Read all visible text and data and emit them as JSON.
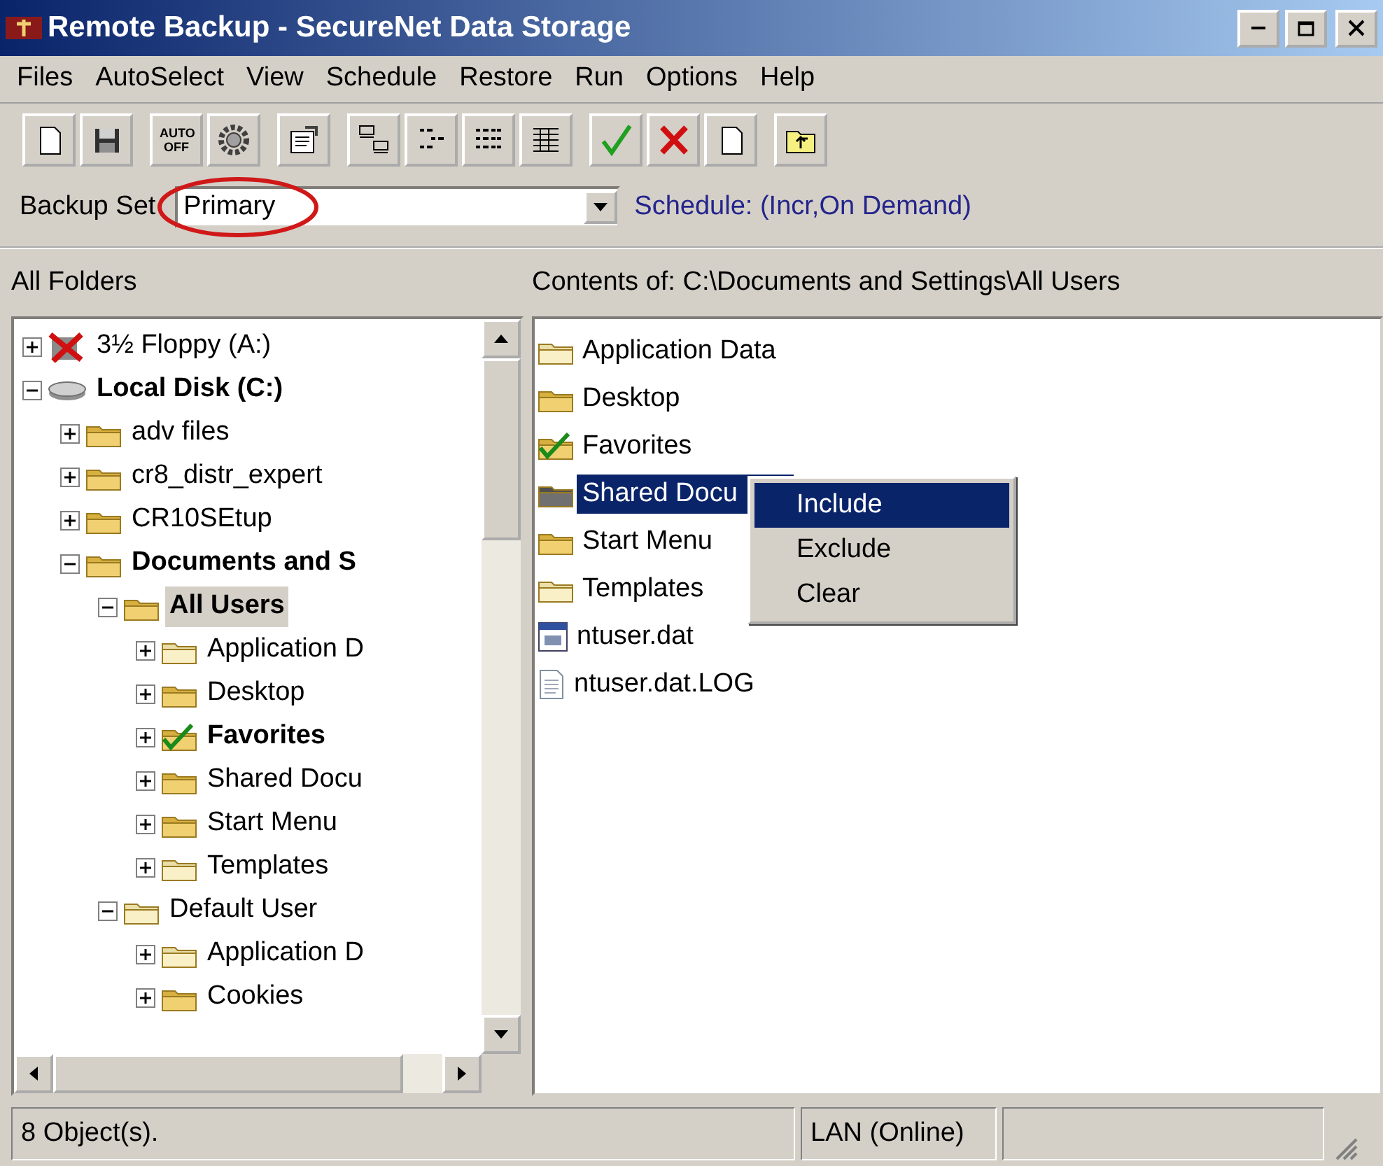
{
  "window": {
    "title": "Remote Backup - SecureNet Data Storage"
  },
  "menu": [
    {
      "label": "Files"
    },
    {
      "label": "AutoSelect"
    },
    {
      "label": "View"
    },
    {
      "label": "Schedule"
    },
    {
      "label": "Restore"
    },
    {
      "label": "Run"
    },
    {
      "label": "Options"
    },
    {
      "label": "Help"
    }
  ],
  "toolbar": {
    "auto_button": "AUTO OFF"
  },
  "backup_set": {
    "label": "Backup Set",
    "value": "Primary",
    "circled": true
  },
  "schedule": "Schedule: (Incr,On Demand)",
  "folders_pane": {
    "title": "All Folders",
    "tree": [
      {
        "label": "3½ Floppy (A:)",
        "kind": "floppy",
        "excluded": true,
        "bold": false,
        "selected": false,
        "expanded": false
      },
      {
        "label": "Local Disk (C:)",
        "kind": "disk",
        "bold": true,
        "selected": false,
        "expanded": true,
        "children": [
          {
            "label": "adv files",
            "kind": "folder",
            "faded": false,
            "checked": false,
            "bold": false,
            "selected": false,
            "expanded": false
          },
          {
            "label": "cr8_distr_expert",
            "kind": "folder",
            "faded": false,
            "checked": false,
            "bold": false,
            "selected": false,
            "expanded": false
          },
          {
            "label": "CR10SEtup",
            "kind": "folder",
            "faded": false,
            "checked": false,
            "bold": false,
            "selected": false,
            "expanded": false
          },
          {
            "label": "Documents and S",
            "kind": "folder",
            "faded": false,
            "checked": false,
            "bold": true,
            "selected": false,
            "expanded": true,
            "children": [
              {
                "label": "All Users",
                "kind": "folder",
                "faded": false,
                "checked": false,
                "bold": true,
                "selected": true,
                "expanded": true,
                "children": [
                  {
                    "label": "Application D",
                    "kind": "folder",
                    "faded": true,
                    "checked": false,
                    "bold": false,
                    "selected": false,
                    "expanded": false
                  },
                  {
                    "label": "Desktop",
                    "kind": "folder",
                    "faded": false,
                    "checked": false,
                    "bold": false,
                    "selected": false,
                    "expanded": false
                  },
                  {
                    "label": "Favorites",
                    "kind": "folder",
                    "faded": false,
                    "checked": true,
                    "bold": true,
                    "selected": false,
                    "expanded": false
                  },
                  {
                    "label": "Shared Docu",
                    "kind": "folder",
                    "faded": false,
                    "checked": false,
                    "bold": false,
                    "selected": false,
                    "expanded": false
                  },
                  {
                    "label": "Start Menu",
                    "kind": "folder",
                    "faded": false,
                    "checked": false,
                    "bold": false,
                    "selected": false,
                    "expanded": false
                  },
                  {
                    "label": "Templates",
                    "kind": "folder",
                    "faded": true,
                    "checked": false,
                    "bold": false,
                    "selected": false,
                    "expanded": false
                  }
                ]
              },
              {
                "label": "Default User",
                "kind": "folder",
                "faded": true,
                "checked": false,
                "bold": false,
                "selected": false,
                "expanded": true,
                "children": [
                  {
                    "label": "Application D",
                    "kind": "folder",
                    "faded": true,
                    "checked": false,
                    "bold": false,
                    "selected": false,
                    "expanded": false
                  },
                  {
                    "label": "Cookies",
                    "kind": "folder",
                    "faded": false,
                    "checked": false,
                    "bold": false,
                    "selected": false,
                    "expanded": false
                  }
                ]
              }
            ]
          }
        ]
      }
    ]
  },
  "contents_pane": {
    "title": "Contents of: C:\\Documents and Settings\\All Users",
    "items": [
      {
        "label": "Application Data",
        "kind": "folder",
        "faded": true,
        "checked": false,
        "selected": false
      },
      {
        "label": "Desktop",
        "kind": "folder",
        "faded": false,
        "checked": false,
        "selected": false
      },
      {
        "label": "Favorites",
        "kind": "folder",
        "faded": false,
        "checked": true,
        "selected": false
      },
      {
        "label": "Shared Docu",
        "kind": "folder",
        "checked": false,
        "selected": true
      },
      {
        "label": "Start Menu",
        "kind": "folder",
        "faded": false,
        "checked": false,
        "selected": false
      },
      {
        "label": "Templates",
        "kind": "folder",
        "faded": true,
        "checked": false,
        "selected": false
      },
      {
        "label": "ntuser.dat",
        "kind": "program",
        "selected": false
      },
      {
        "label": "ntuser.dat.LOG",
        "kind": "document",
        "selected": false
      }
    ]
  },
  "context_menu": [
    {
      "label": "Include",
      "selected": true
    },
    {
      "label": "Exclude",
      "selected": false
    },
    {
      "label": "Clear",
      "selected": false
    }
  ],
  "status_bar": [
    "8 Object(s).",
    "LAN (Online)"
  ]
}
